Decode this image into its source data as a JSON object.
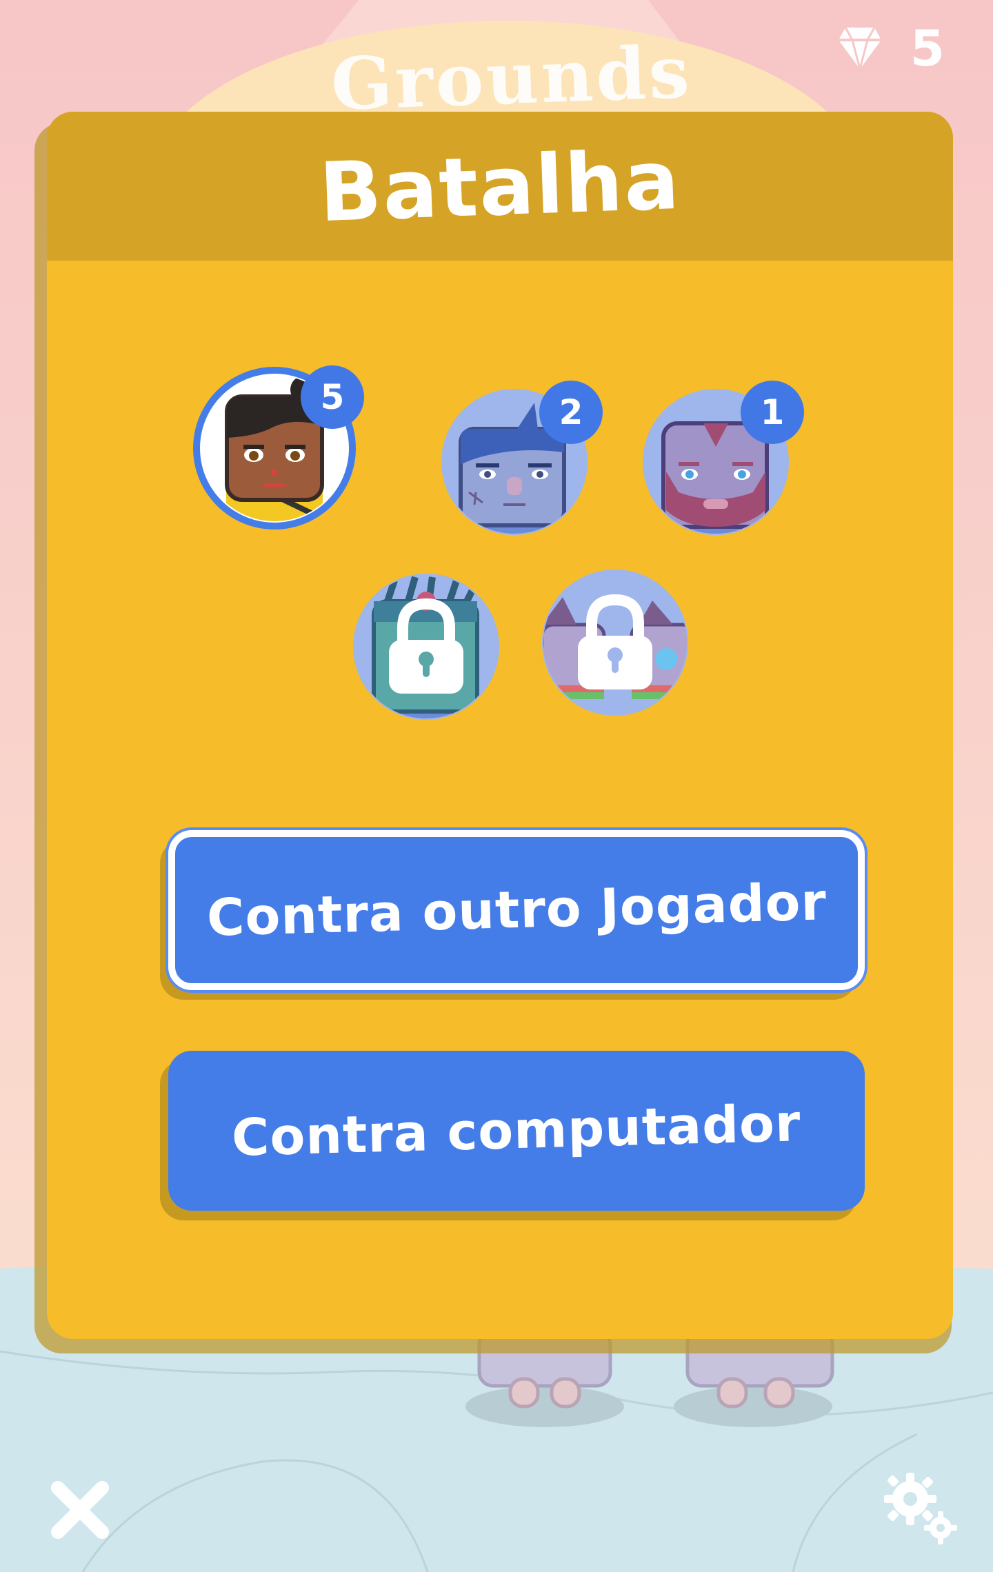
{
  "header": {
    "gem_count": "5",
    "background_title": "Grounds"
  },
  "dialog": {
    "title": "Batalha"
  },
  "characters": [
    {
      "badge": "5",
      "locked": false,
      "selected": true
    },
    {
      "badge": "2",
      "locked": false,
      "selected": false
    },
    {
      "badge": "1",
      "locked": false,
      "selected": false
    },
    {
      "locked": true
    },
    {
      "locked": true
    }
  ],
  "buttons": {
    "vs_player": "Contra outro Jogador",
    "vs_computer": "Contra computador"
  },
  "footer": {
    "close_icon": "close-icon",
    "settings_icon": "gears-icon"
  },
  "colors": {
    "panel": "#f6bc2a",
    "panel_header": "#d5a325",
    "button": "#447de8",
    "badge": "#4278e6",
    "sky": "#f7c8c6",
    "sea": "#cfe6ec"
  }
}
